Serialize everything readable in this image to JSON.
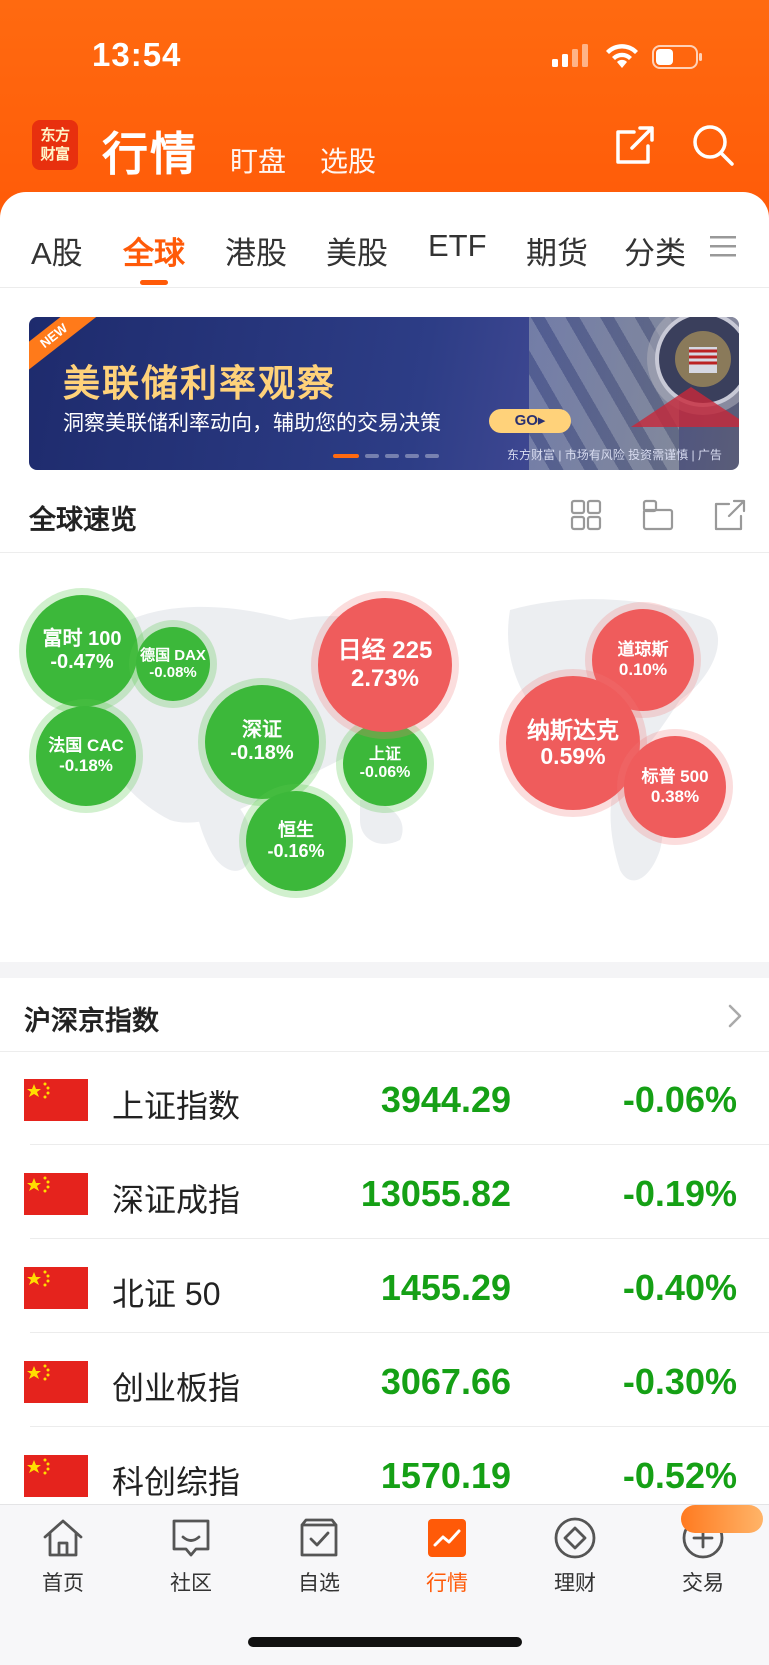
{
  "status_bar": {
    "time": "13:54"
  },
  "header": {
    "logo_text": "东方财富",
    "title": "行情",
    "sub_tabs": [
      "盯盘",
      "选股"
    ],
    "share_icon": "share-icon",
    "search_icon": "search-icon",
    "brand_color": "#ff5a08"
  },
  "tabs": {
    "items": [
      "A股",
      "全球",
      "港股",
      "美股",
      "ETF",
      "期货",
      "分类"
    ],
    "active": "全球"
  },
  "banner": {
    "badge": "NEW",
    "title": "美联储利率观察",
    "subtitle": "洞察美联储利率动向，辅助您的交易决策",
    "go_label": "GO▸",
    "footer": "东方财富 | 市场有风险 投资需谨慎 | 广告"
  },
  "overview": {
    "title": "全球速览",
    "bubbles": [
      {
        "name": "富时 100",
        "change": "-0.47%",
        "trend": "down"
      },
      {
        "name": "德国 DAX",
        "change": "-0.08%",
        "trend": "down"
      },
      {
        "name": "法国 CAC",
        "change": "-0.18%",
        "trend": "down"
      },
      {
        "name": "深证",
        "change": "-0.18%",
        "trend": "down"
      },
      {
        "name": "恒生",
        "change": "-0.16%",
        "trend": "down"
      },
      {
        "name": "上证",
        "change": "-0.06%",
        "trend": "down"
      },
      {
        "name": "日经 225",
        "change": "2.73%",
        "trend": "up"
      },
      {
        "name": "道琼斯",
        "change": "0.10%",
        "trend": "up"
      },
      {
        "name": "纳斯达克",
        "change": "0.59%",
        "trend": "up"
      },
      {
        "name": "标普 500",
        "change": "0.38%",
        "trend": "up"
      }
    ]
  },
  "index_section": {
    "title": "沪深京指数",
    "rows": [
      {
        "name": "上证指数",
        "price": "3944.29",
        "change": "-0.06%"
      },
      {
        "name": "深证成指",
        "price": "13055.82",
        "change": "-0.19%"
      },
      {
        "name": "北证 50",
        "price": "1455.29",
        "change": "-0.40%"
      },
      {
        "name": "创业板指",
        "price": "3067.66",
        "change": "-0.30%"
      },
      {
        "name": "科创综指",
        "price": "1570.19",
        "change": "-0.52%"
      }
    ]
  },
  "bottom_nav": {
    "items": [
      {
        "label": "首页",
        "icon": "home-icon"
      },
      {
        "label": "社区",
        "icon": "community-icon"
      },
      {
        "label": "自选",
        "icon": "watchlist-icon"
      },
      {
        "label": "行情",
        "icon": "market-icon"
      },
      {
        "label": "理财",
        "icon": "wealth-icon"
      },
      {
        "label": "交易",
        "icon": "trade-icon"
      }
    ],
    "active": "行情"
  },
  "colors": {
    "up": "#ef5c5c",
    "down": "#3cb83a",
    "accent": "#ff5a08"
  }
}
